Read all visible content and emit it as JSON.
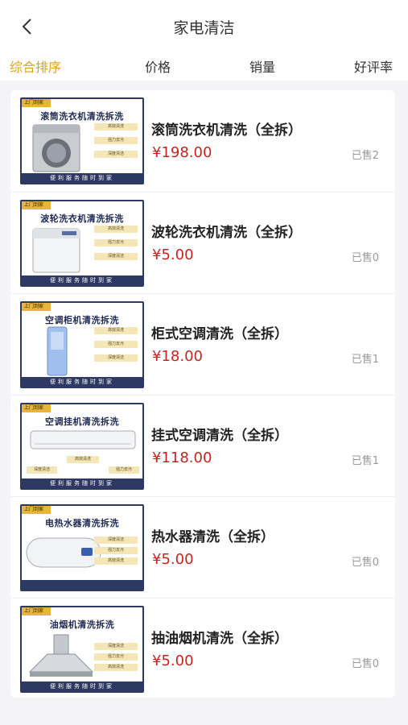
{
  "header": {
    "title": "家电清洁",
    "back_icon": "chevron-left-icon"
  },
  "sort_tabs": [
    {
      "label": "综合排序",
      "active": true
    },
    {
      "label": "价格",
      "active": false
    },
    {
      "label": "销量",
      "active": false
    },
    {
      "label": "好评率",
      "active": false
    }
  ],
  "accent_color": "#d9a31a",
  "price_color": "#c8241d",
  "products": [
    {
      "name": "滚筒洗衣机清洗（全拆）",
      "price": "¥198.00",
      "sold": "已售2",
      "thumb": {
        "badge": "上门到家",
        "title": "滚筒洗衣机清洗拆洗",
        "tags": [
          "高效清洗",
          "强力去污",
          "深度清洁"
        ],
        "footer": "便利服务随时到家",
        "icon": "front-load-washer-icon"
      }
    },
    {
      "name": "波轮洗衣机清洗（全拆）",
      "price": "¥5.00",
      "sold": "已售0",
      "thumb": {
        "badge": "上门到家",
        "title": "波轮洗衣机清洗拆洗",
        "tags": [
          "高效清洗",
          "强力去污",
          "深度清洁"
        ],
        "footer": "便利服务随时到家",
        "icon": "top-load-washer-icon"
      }
    },
    {
      "name": "柜式空调清洗（全拆）",
      "price": "¥18.00",
      "sold": "已售1",
      "thumb": {
        "badge": "上门到家",
        "title": "空调柜机清洗拆洗",
        "tags": [
          "高效清洗",
          "强力去污",
          "深度清洁"
        ],
        "footer": "便利服务随时到家",
        "icon": "floor-ac-icon"
      }
    },
    {
      "name": "挂式空调清洗（全拆）",
      "price": "¥118.00",
      "sold": "已售1",
      "thumb": {
        "badge": "上门到家",
        "title": "空调挂机清洗拆洗",
        "tags": [
          "高效清洗",
          "深度清洁",
          "强力去污"
        ],
        "footer": "便利服务随时到家",
        "icon": "wall-ac-icon"
      }
    },
    {
      "name": "热水器清洗（全拆）",
      "price": "¥5.00",
      "sold": "已售0",
      "thumb": {
        "badge": "上门到家",
        "title": "电热水器清洗拆洗",
        "tags": [
          "深度清洁",
          "强力去污",
          "高效清洗"
        ],
        "footer": "",
        "icon": "water-heater-icon"
      }
    },
    {
      "name": "抽油烟机清洗（全拆）",
      "price": "¥5.00",
      "sold": "已售0",
      "thumb": {
        "badge": "上门到家",
        "title": "油烟机清洗拆洗",
        "tags": [
          "深度清洁",
          "强力去污",
          "高效清洗"
        ],
        "footer": "便利服务随时到家",
        "icon": "range-hood-icon"
      }
    }
  ]
}
